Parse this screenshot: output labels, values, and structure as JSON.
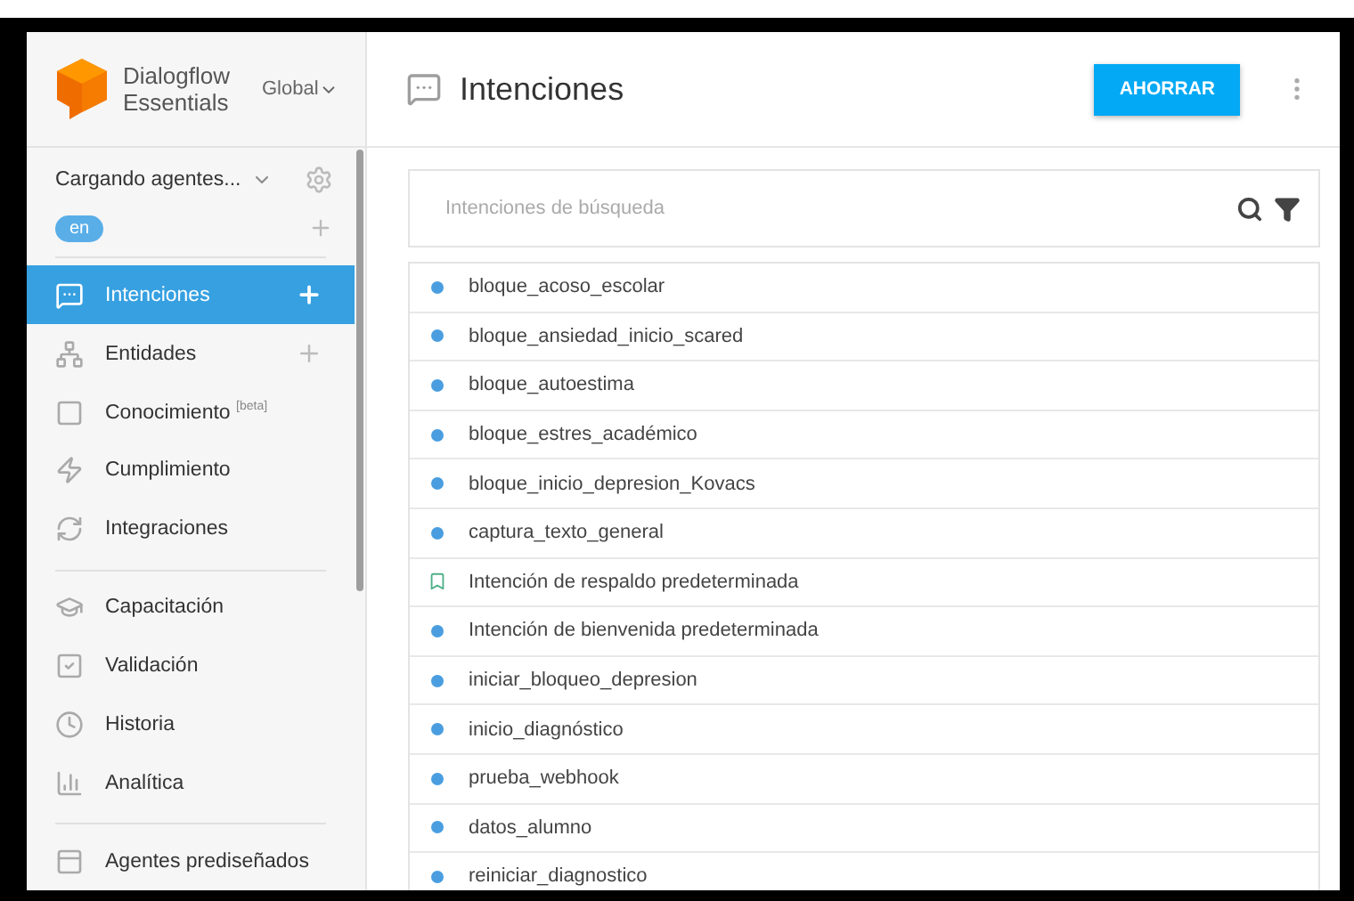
{
  "brand": {
    "line1": "Dialogflow",
    "line2": "Essentials",
    "region": "Global"
  },
  "agent": {
    "name": "Cargando agentes...",
    "language": "en"
  },
  "nav_sections": [
    {
      "items": [
        {
          "label": "Intenciones",
          "selected": true,
          "addable": true
        },
        {
          "label": "Entidades",
          "selected": false,
          "addable": true
        },
        {
          "label": "Conocimiento $^{[beta]}$",
          "selected": false,
          "addable": false
        },
        {
          "label": "Cumplimiento",
          "selected": false,
          "addable": false
        },
        {
          "label": "Integraciones",
          "selected": false,
          "addable": false
        }
      ]
    },
    {
      "items": [
        {
          "label": "Capacitación",
          "selected": false,
          "addable": false
        },
        {
          "label": "Validación",
          "selected": false,
          "addable": false
        },
        {
          "label": "Historia",
          "selected": false,
          "addable": false
        },
        {
          "label": "Analítica",
          "selected": false,
          "addable": false
        }
      ]
    },
    {
      "items": [
        {
          "label": "Agentes prediseñados",
          "selected": false,
          "addable": false
        }
      ]
    }
  ],
  "page": {
    "title": "Intenciones",
    "save_button": "AHORRAR"
  },
  "search": {
    "placeholder": "Intenciones de búsqueda"
  },
  "intents": [
    {
      "name": "bloque_acoso_escolar",
      "kind": "regular"
    },
    {
      "name": "bloque_ansiedad_inicio_scared",
      "kind": "regular"
    },
    {
      "name": "bloque_autoestima",
      "kind": "regular"
    },
    {
      "name": "bloque_estres_académico",
      "kind": "regular"
    },
    {
      "name": "bloque_inicio_depresion_Kovacs",
      "kind": "regular"
    },
    {
      "name": "captura_texto_general",
      "kind": "regular"
    },
    {
      "name": "Intención de respaldo predeterminada",
      "kind": "fallback"
    },
    {
      "name": "Intención de bienvenida predeterminada",
      "kind": "regular"
    },
    {
      "name": "iniciar_bloqueo_depresion",
      "kind": "regular"
    },
    {
      "name": "inicio_diagnóstico",
      "kind": "regular"
    },
    {
      "name": "prueba_webhook",
      "kind": "regular"
    },
    {
      "name": "datos_alumno",
      "kind": "regular"
    },
    {
      "name": "reiniciar_diagnostico",
      "kind": "regular"
    }
  ]
}
